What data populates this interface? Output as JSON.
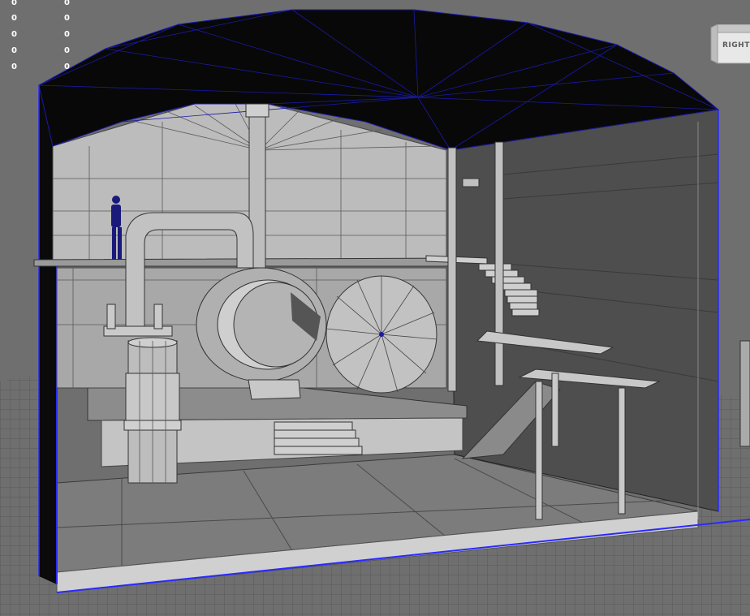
{
  "viewport": {
    "background_color": "#6f6f6f",
    "wireframe_color": "#1a1aa8",
    "selection_edge_color": "#2a2aff",
    "geometry_fill": "#b8b8b8"
  },
  "hud": {
    "rows": [
      {
        "left": "0",
        "right": "0"
      },
      {
        "left": "0",
        "right": "0"
      },
      {
        "left": "0",
        "right": "0"
      },
      {
        "left": "0",
        "right": "0"
      },
      {
        "left": "0",
        "right": "0"
      }
    ]
  },
  "viewcube": {
    "label": "RIGHT"
  },
  "scene": {
    "character_icon": "human-figure-icon"
  }
}
